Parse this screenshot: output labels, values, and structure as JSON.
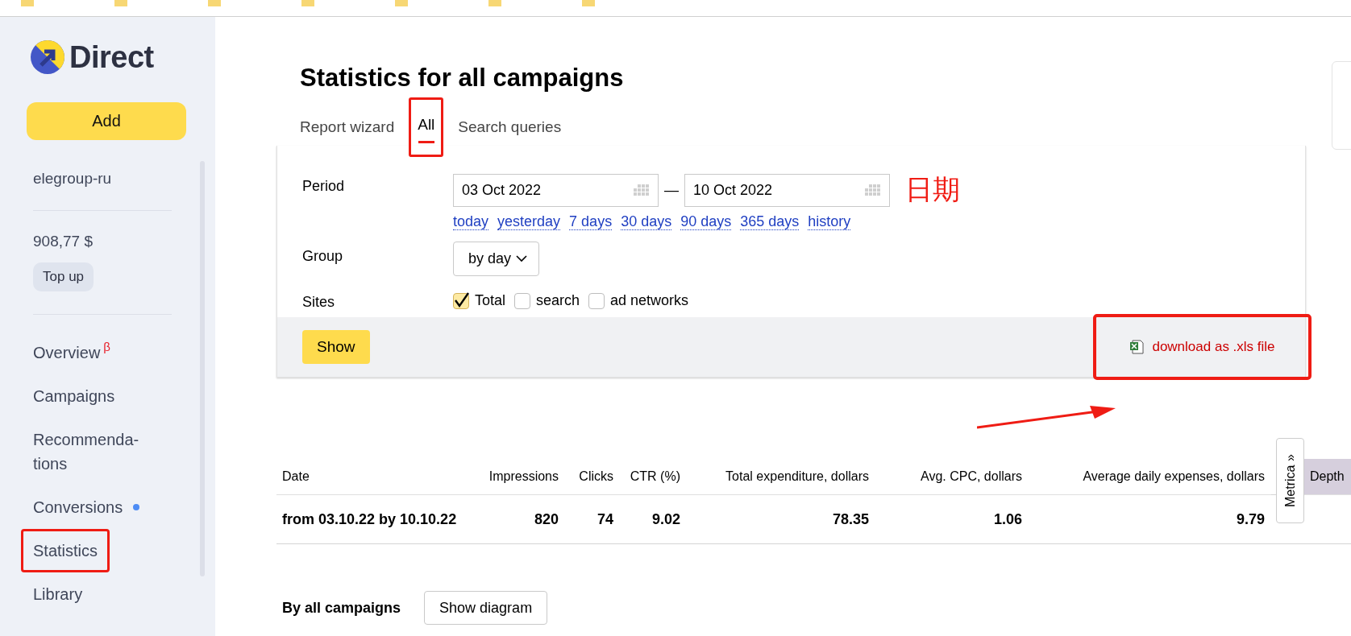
{
  "bookmarks": [
    {
      "kind": "folder"
    },
    {
      "kind": "folder"
    },
    {
      "kind": "folder"
    },
    {
      "kind": "folder"
    },
    {
      "kind": "folder"
    },
    {
      "kind": "folder"
    },
    {
      "kind": "folder"
    }
  ],
  "sidebar": {
    "logo": "Direct",
    "add_button": "Add",
    "account": "elegroup-ru",
    "balance": "908,77 $",
    "top_up_button": "Top up",
    "nav": [
      {
        "label": "Overview",
        "badge": "β",
        "dot": false,
        "highlighted": false
      },
      {
        "label": "Campaigns",
        "dot": false,
        "highlighted": false
      },
      {
        "label": "Recommenda-tions",
        "dot": false,
        "highlighted": false
      },
      {
        "label": "Conversions",
        "dot": true,
        "highlighted": false
      },
      {
        "label": "Statistics",
        "dot": false,
        "highlighted": true
      },
      {
        "label": "Library",
        "dot": false,
        "highlighted": false
      }
    ]
  },
  "title": "Statistics for all campaigns",
  "tabs": [
    {
      "label": "Report wizard",
      "selected": false,
      "highlighted": false
    },
    {
      "label": "All",
      "selected": true,
      "highlighted": true
    },
    {
      "label": "Search queries",
      "selected": false,
      "highlighted": false
    }
  ],
  "filter": {
    "period_label": "Period",
    "date_from": "03 Oct 2022",
    "date_separator": "—",
    "date_to": "10 Oct 2022",
    "date_note": "日期",
    "presets": [
      "today",
      "yesterday",
      "7 days",
      "30 days",
      "90 days",
      "365 days",
      "history"
    ],
    "group_label": "Group",
    "group_value": "by day",
    "sites_label": "Sites",
    "sites": [
      {
        "label": "Total",
        "checked": true
      },
      {
        "label": "search",
        "checked": false
      },
      {
        "label": "ad networks",
        "checked": false
      }
    ],
    "show_button": "Show",
    "download_link": "download as .xls file",
    "download_highlighted": true
  },
  "table": {
    "columns": [
      {
        "label": "Date",
        "kind": "text"
      },
      {
        "label": "Impressions",
        "kind": "number"
      },
      {
        "label": "Clicks",
        "kind": "number"
      },
      {
        "label": "CTR (%)",
        "kind": "number"
      },
      {
        "label": "Total expenditure, dollars",
        "kind": "number"
      },
      {
        "label": "Avg. CPC, dollars",
        "kind": "number"
      },
      {
        "label": "Average daily expenses, dollars",
        "kind": "number"
      },
      {
        "label": "Depth",
        "kind": "extra"
      }
    ],
    "rows": [
      {
        "cells": [
          "from 03.10.22 by 10.10.22",
          "820",
          "74",
          "9.02",
          "78.35",
          "1.06",
          "9.79"
        ]
      }
    ],
    "metrica_tab": "Metrica »"
  },
  "summary": {
    "label": "By all campaigns",
    "diagram_button": "Show diagram"
  }
}
